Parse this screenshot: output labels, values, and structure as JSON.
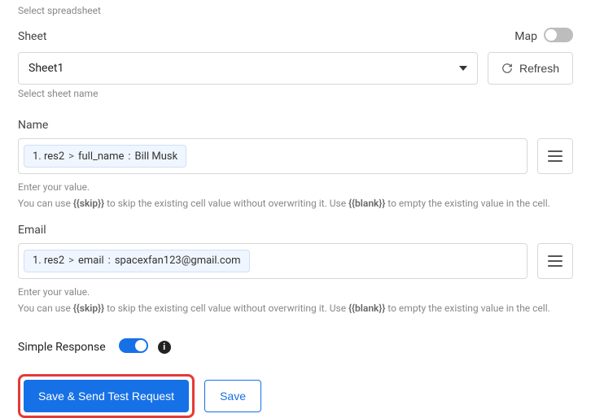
{
  "top_hint": "Select spreadsheet",
  "sheet": {
    "label": "Sheet",
    "map_label": "Map",
    "map_on": false,
    "value": "Sheet1",
    "hint": "Select sheet name",
    "refresh_label": "Refresh"
  },
  "fields": [
    {
      "label": "Name",
      "token_prefix": "1. res2",
      "token_key": "full_name",
      "token_value": "Bill Musk",
      "help_line1": "Enter your value.",
      "help_line2a": "You can use ",
      "skip_tag": "{{skip}}",
      "help_line2b": " to skip the existing cell value without overwriting it. Use ",
      "blank_tag": "{{blank}}",
      "help_line2c": " to empty the existing value in the cell."
    },
    {
      "label": "Email",
      "token_prefix": "1. res2",
      "token_key": "email",
      "token_value": "spacexfan123@gmail.com",
      "help_line1": "Enter your value.",
      "help_line2a": "You can use ",
      "skip_tag": "{{skip}}",
      "help_line2b": " to skip the existing cell value without overwriting it. Use ",
      "blank_tag": "{{blank}}",
      "help_line2c": " to empty the existing value in the cell."
    }
  ],
  "simple_response": {
    "label": "Simple Response",
    "on": true
  },
  "buttons": {
    "primary": "Save & Send Test Request",
    "secondary": "Save"
  }
}
